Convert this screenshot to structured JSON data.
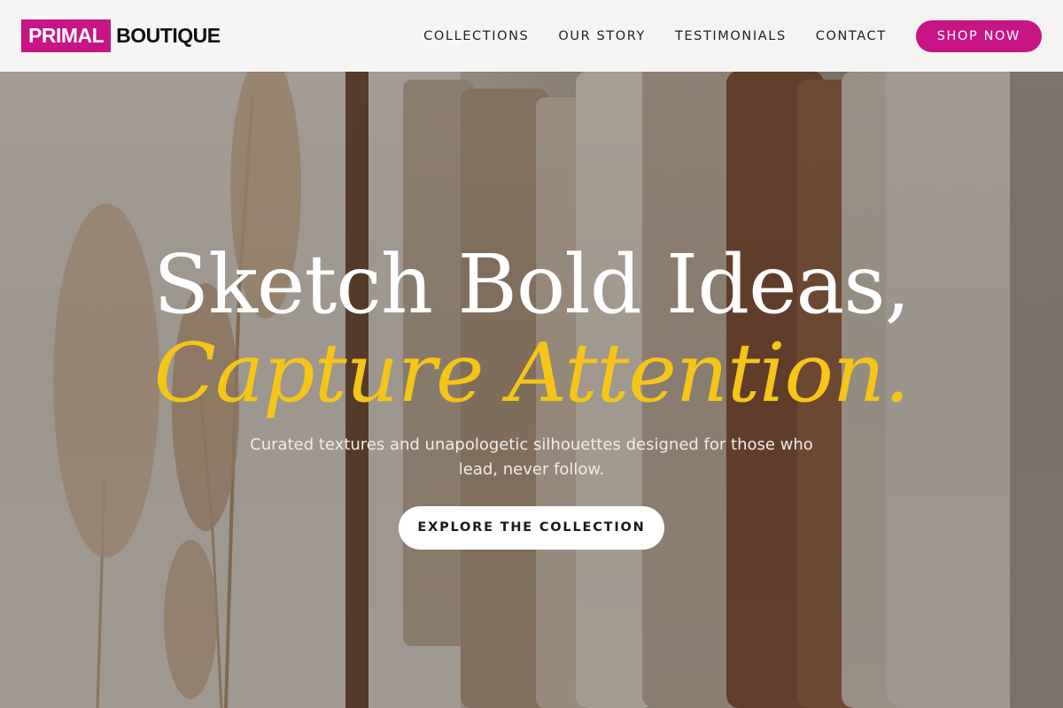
{
  "header": {
    "logo_primary": "PRIMAL",
    "logo_secondary": "BOUTIQUE",
    "nav": [
      {
        "label": "COLLECTIONS"
      },
      {
        "label": "OUR STORY"
      },
      {
        "label": "TESTIMONIALS"
      },
      {
        "label": "CONTACT"
      }
    ],
    "shop_label": "SHOP NOW"
  },
  "hero": {
    "headline": "Sketch Bold Ideas,",
    "headline_accent": "Capture Attention.",
    "subtitle": "Curated textures and unapologetic silhouettes designed for those who lead, never follow.",
    "cta_label": "EXPLORE THE COLLECTION"
  },
  "colors": {
    "brand": "#c71585",
    "accent": "#f5c518",
    "headline": "#ffffff",
    "header_bg": "#faf9f8"
  }
}
